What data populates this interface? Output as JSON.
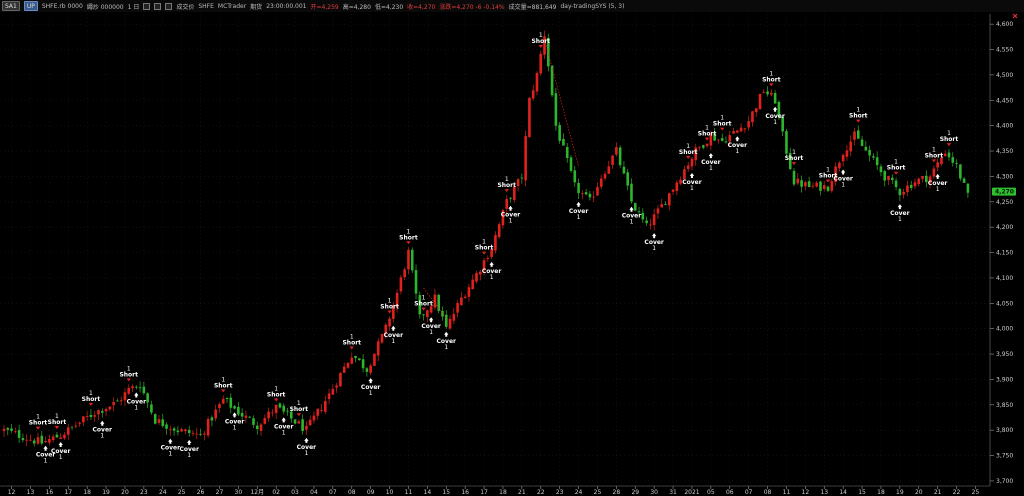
{
  "toolbar": {
    "symbol_button": "SA1",
    "up_button": "UP",
    "symbol": "SHFE.rb 0000",
    "wave_label": "繩炒 000000",
    "period": "1 日",
    "mode_label": "成交价",
    "exchange": "SHFE",
    "source": "MCTrader",
    "date_label": "期货",
    "time": "23:00:00.001",
    "open": "开=4,259",
    "high": "高=4,280",
    "low": "低=4,230",
    "close": "收=4,270",
    "change": "涨跌=4,270 -6 -0.14%",
    "volume": "成交量=881,649",
    "strategy": "day-tradingSYS (5, 3)"
  },
  "chart_data": {
    "type": "candlestick",
    "ylim": [
      3690,
      4620
    ],
    "y_ticks": [
      3700,
      3750,
      3800,
      3850,
      3900,
      3950,
      4000,
      4050,
      4100,
      4150,
      4200,
      4250,
      4300,
      4350,
      4400,
      4450,
      4500,
      4550,
      4600
    ],
    "y_tick_labels": [
      "3,700",
      "3,750",
      "3,800",
      "3,850",
      "3,900",
      "3,950",
      "4,000",
      "4,050",
      "4,100",
      "4,150",
      "4,200",
      "4,250",
      "4,300",
      "4,350",
      "4,400",
      "4,450",
      "4,500",
      "4,550",
      "4,600"
    ],
    "current_price_label": "4,270",
    "current_price": 4270,
    "date_labels": [
      {
        "i": 2,
        "t": "12"
      },
      {
        "i": 7,
        "t": "13"
      },
      {
        "i": 12,
        "t": "16"
      },
      {
        "i": 17,
        "t": "17"
      },
      {
        "i": 22,
        "t": "18"
      },
      {
        "i": 27,
        "t": "19"
      },
      {
        "i": 32,
        "t": "20"
      },
      {
        "i": 37,
        "t": "23"
      },
      {
        "i": 42,
        "t": "24"
      },
      {
        "i": 47,
        "t": "25"
      },
      {
        "i": 52,
        "t": "26"
      },
      {
        "i": 57,
        "t": "27"
      },
      {
        "i": 62,
        "t": "30"
      },
      {
        "i": 67,
        "t": "12月"
      },
      {
        "i": 72,
        "t": "02"
      },
      {
        "i": 77,
        "t": "03"
      },
      {
        "i": 82,
        "t": "04"
      },
      {
        "i": 87,
        "t": "07"
      },
      {
        "i": 92,
        "t": "08"
      },
      {
        "i": 97,
        "t": "09"
      },
      {
        "i": 102,
        "t": "10"
      },
      {
        "i": 107,
        "t": "11"
      },
      {
        "i": 112,
        "t": "14"
      },
      {
        "i": 117,
        "t": "15"
      },
      {
        "i": 122,
        "t": "16"
      },
      {
        "i": 127,
        "t": "17"
      },
      {
        "i": 132,
        "t": "18"
      },
      {
        "i": 137,
        "t": "21"
      },
      {
        "i": 142,
        "t": "22"
      },
      {
        "i": 147,
        "t": "23"
      },
      {
        "i": 152,
        "t": "24"
      },
      {
        "i": 157,
        "t": "25"
      },
      {
        "i": 162,
        "t": "28"
      },
      {
        "i": 167,
        "t": "29"
      },
      {
        "i": 172,
        "t": "30"
      },
      {
        "i": 177,
        "t": "31"
      },
      {
        "i": 182,
        "t": "2021"
      },
      {
        "i": 187,
        "t": "05"
      },
      {
        "i": 192,
        "t": "06"
      },
      {
        "i": 197,
        "t": "07"
      },
      {
        "i": 202,
        "t": "08"
      },
      {
        "i": 207,
        "t": "11"
      },
      {
        "i": 212,
        "t": "12"
      },
      {
        "i": 217,
        "t": "13"
      },
      {
        "i": 222,
        "t": "14"
      },
      {
        "i": 227,
        "t": "15"
      },
      {
        "i": 232,
        "t": "18"
      },
      {
        "i": 237,
        "t": "19"
      },
      {
        "i": 242,
        "t": "20"
      },
      {
        "i": 247,
        "t": "21"
      },
      {
        "i": 252,
        "t": "22"
      },
      {
        "i": 257,
        "t": "25"
      }
    ],
    "anchors": [
      [
        0,
        3800
      ],
      [
        10,
        3775
      ],
      [
        15,
        3790
      ],
      [
        24,
        3835
      ],
      [
        30,
        3855
      ],
      [
        33,
        3880
      ],
      [
        36,
        3890
      ],
      [
        40,
        3820
      ],
      [
        46,
        3800
      ],
      [
        52,
        3790
      ],
      [
        58,
        3860
      ],
      [
        63,
        3830
      ],
      [
        67,
        3810
      ],
      [
        72,
        3845
      ],
      [
        80,
        3800
      ],
      [
        86,
        3870
      ],
      [
        92,
        3950
      ],
      [
        96,
        3920
      ],
      [
        101,
        4000
      ],
      [
        104,
        4070
      ],
      [
        107,
        4150
      ],
      [
        110,
        4020
      ],
      [
        114,
        4060
      ],
      [
        117,
        4000
      ],
      [
        121,
        4060
      ],
      [
        126,
        4120
      ],
      [
        129,
        4160
      ],
      [
        133,
        4250
      ],
      [
        137,
        4300
      ],
      [
        139,
        4450
      ],
      [
        141,
        4500
      ],
      [
        143,
        4580
      ],
      [
        146,
        4400
      ],
      [
        151,
        4280
      ],
      [
        155,
        4250
      ],
      [
        158,
        4300
      ],
      [
        162,
        4350
      ],
      [
        166,
        4250
      ],
      [
        170,
        4200
      ],
      [
        173,
        4230
      ],
      [
        178,
        4290
      ],
      [
        183,
        4350
      ],
      [
        187,
        4380
      ],
      [
        190,
        4370
      ],
      [
        194,
        4390
      ],
      [
        197,
        4410
      ],
      [
        201,
        4470
      ],
      [
        204,
        4450
      ],
      [
        206,
        4380
      ],
      [
        209,
        4290
      ],
      [
        213,
        4280
      ],
      [
        218,
        4280
      ],
      [
        222,
        4350
      ],
      [
        225,
        4380
      ],
      [
        229,
        4340
      ],
      [
        233,
        4300
      ],
      [
        237,
        4270
      ],
      [
        241,
        4290
      ],
      [
        245,
        4300
      ],
      [
        249,
        4350
      ],
      [
        252,
        4320
      ],
      [
        255,
        4260
      ]
    ],
    "signals": [
      {
        "i": 9,
        "type": "Short",
        "qty": "1"
      },
      {
        "i": 11,
        "type": "Cover",
        "qty": "1"
      },
      {
        "i": 14,
        "type": "Short",
        "qty": "1"
      },
      {
        "i": 15,
        "type": "Cover",
        "qty": "1"
      },
      {
        "i": 23,
        "type": "Short",
        "qty": "1"
      },
      {
        "i": 26,
        "type": "Cover",
        "qty": "1"
      },
      {
        "i": 33,
        "type": "Short",
        "qty": "1"
      },
      {
        "i": 35,
        "type": "Cover",
        "qty": "1"
      },
      {
        "i": 44,
        "type": "Cover",
        "qty": "1"
      },
      {
        "i": 49,
        "type": "Cover",
        "qty": "1"
      },
      {
        "i": 58,
        "type": "Short",
        "qty": "1"
      },
      {
        "i": 61,
        "type": "Cover",
        "qty": "1"
      },
      {
        "i": 72,
        "type": "Short",
        "qty": "1"
      },
      {
        "i": 74,
        "type": "Cover",
        "qty": "1"
      },
      {
        "i": 78,
        "type": "Short",
        "qty": "1"
      },
      {
        "i": 80,
        "type": "Cover",
        "qty": "1"
      },
      {
        "i": 92,
        "type": "Short",
        "qty": "1"
      },
      {
        "i": 97,
        "type": "Cover",
        "qty": "1"
      },
      {
        "i": 102,
        "type": "Short",
        "qty": "1"
      },
      {
        "i": 103,
        "type": "Cover",
        "qty": "1"
      },
      {
        "i": 107,
        "type": "Short",
        "qty": "1"
      },
      {
        "i": 111,
        "type": "Short",
        "qty": "1"
      },
      {
        "i": 113,
        "type": "Cover",
        "qty": "1"
      },
      {
        "i": 117,
        "type": "Cover",
        "qty": "1"
      },
      {
        "i": 127,
        "type": "Short",
        "qty": "1"
      },
      {
        "i": 129,
        "type": "Cover",
        "qty": "1"
      },
      {
        "i": 133,
        "type": "Short",
        "qty": "1"
      },
      {
        "i": 134,
        "type": "Cover",
        "qty": "1"
      },
      {
        "i": 142,
        "type": "Short",
        "qty": "1"
      },
      {
        "i": 152,
        "type": "Cover",
        "qty": "1"
      },
      {
        "i": 166,
        "type": "Cover",
        "qty": "1"
      },
      {
        "i": 172,
        "type": "Cover",
        "qty": "1"
      },
      {
        "i": 181,
        "type": "Short",
        "qty": "1"
      },
      {
        "i": 182,
        "type": "Cover",
        "qty": "1"
      },
      {
        "i": 186,
        "type": "Short",
        "qty": "1"
      },
      {
        "i": 187,
        "type": "Cover",
        "qty": "1"
      },
      {
        "i": 190,
        "type": "Short",
        "qty": "1"
      },
      {
        "i": 194,
        "type": "Cover",
        "qty": "1"
      },
      {
        "i": 203,
        "type": "Short",
        "qty": "1"
      },
      {
        "i": 204,
        "type": "Cover",
        "qty": "1"
      },
      {
        "i": 209,
        "type": "Short",
        "qty": "1"
      },
      {
        "i": 218,
        "type": "Short",
        "qty": "1"
      },
      {
        "i": 222,
        "type": "Cover",
        "qty": "1"
      },
      {
        "i": 226,
        "type": "Short",
        "qty": "1"
      },
      {
        "i": 236,
        "type": "Short",
        "qty": "1"
      },
      {
        "i": 237,
        "type": "Cover",
        "qty": "1"
      },
      {
        "i": 246,
        "type": "Short",
        "qty": "1"
      },
      {
        "i": 247,
        "type": "Cover",
        "qty": "1"
      },
      {
        "i": 250,
        "type": "Short",
        "qty": "1"
      }
    ],
    "colors": {
      "up": "#e0221e",
      "down": "#2db52d",
      "background": "#000000",
      "grid": "#2a2a2a",
      "axis_text": "#cfcfcf",
      "price_marker": "#2fbf2f",
      "dotted_line": "#e0221e"
    }
  }
}
